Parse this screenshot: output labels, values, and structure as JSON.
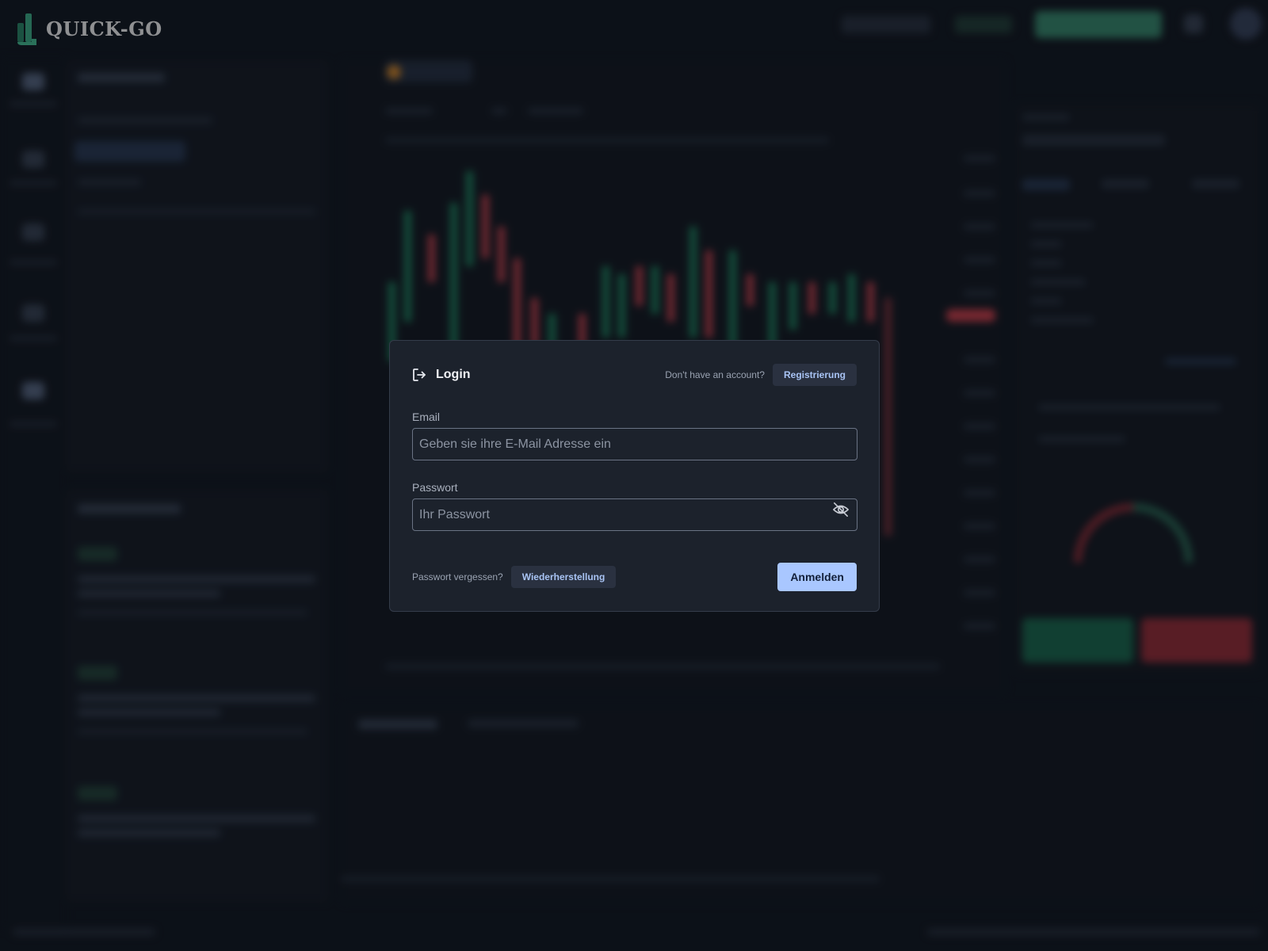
{
  "app": {
    "brand_name": "QUICK-GO"
  },
  "login": {
    "title": "Login",
    "no_account_text": "Don't have an account?",
    "register_label": "Registrierung",
    "email_label": "Email",
    "email_placeholder": "Geben sie ihre E-Mail Adresse ein",
    "password_label": "Passwort",
    "password_placeholder": "Ihr Passwort",
    "forgot_text": "Passwort vergessen?",
    "recover_label": "Wiederherstellung",
    "submit_label": "Anmelden"
  },
  "icons": {
    "login": "login-arrow-icon",
    "password_toggle": "eye-off-icon",
    "brand": "quick-go-logo"
  },
  "colors": {
    "accent": "#a9c7ff",
    "brand": "#3fb58c",
    "modal_bg": "#1c222c",
    "page_bg": "#121821",
    "bull": "#1f8a63",
    "bear": "#c9434f"
  }
}
